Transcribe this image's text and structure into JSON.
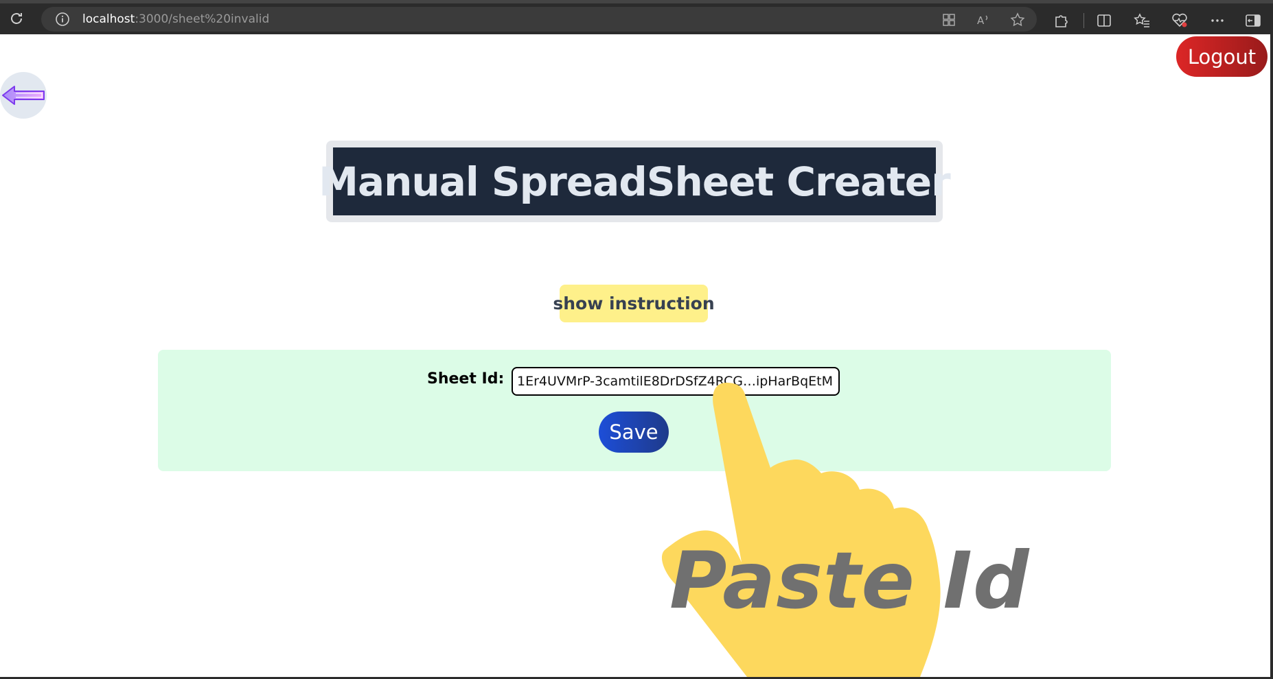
{
  "browser": {
    "url_host": "localhost",
    "url_path": ":3000/sheet%20invalid",
    "icons": [
      "reload-icon",
      "info-icon",
      "app-grid-icon",
      "read-aloud-icon",
      "favorite-star-icon",
      "extensions-icon",
      "split-screen-icon",
      "favorites-icon",
      "health-icon",
      "more-icon",
      "sidebar-icon"
    ]
  },
  "page": {
    "logout_label": "Logout",
    "back_icon": "arrow-left-icon",
    "title": "Manual SpreadSheet Creater",
    "instruction_label": "show instruction",
    "form": {
      "sheet_label": "Sheet Id:",
      "sheet_value": "1Er4UVMrP-3camtilE8DrDSfZ4RCG…ipHarBqEtM",
      "save_label": "Save"
    },
    "overlay": {
      "text": "Paste Id",
      "hand_color": "#fdd85d"
    }
  },
  "colors": {
    "logout": "#dc2626",
    "title_bg": "#1e293b",
    "instruction_bg": "#fef08a",
    "form_bg": "#dcfce7",
    "save": "#1d4ed8"
  }
}
